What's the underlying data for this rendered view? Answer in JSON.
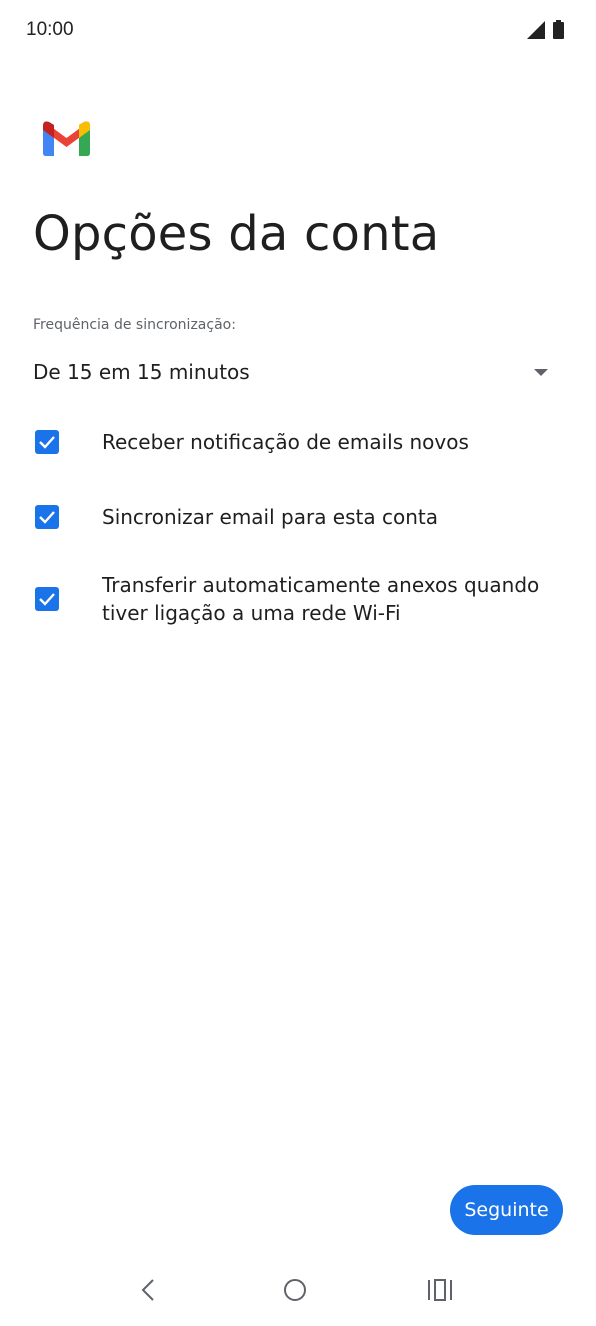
{
  "status_bar": {
    "time": "10:00",
    "icons": [
      "signal-icon",
      "battery-icon"
    ]
  },
  "app": {
    "logo": "gmail-logo",
    "title": "Opções da conta"
  },
  "sync": {
    "label": "Frequência de sincronização:",
    "selected": "De 15 em 15 minutos"
  },
  "options": [
    {
      "label": "Receber notificação de emails novos",
      "checked": true
    },
    {
      "label": "Sincronizar email para esta conta",
      "checked": true
    },
    {
      "label": "Transferir automaticamente anexos quando tiver ligação a uma rede Wi-Fi",
      "checked": true
    }
  ],
  "actions": {
    "next_label": "Seguinte"
  },
  "nav": {
    "buttons": [
      "back-icon",
      "home-icon",
      "recents-icon"
    ]
  },
  "colors": {
    "accent": "#1a73e8"
  }
}
